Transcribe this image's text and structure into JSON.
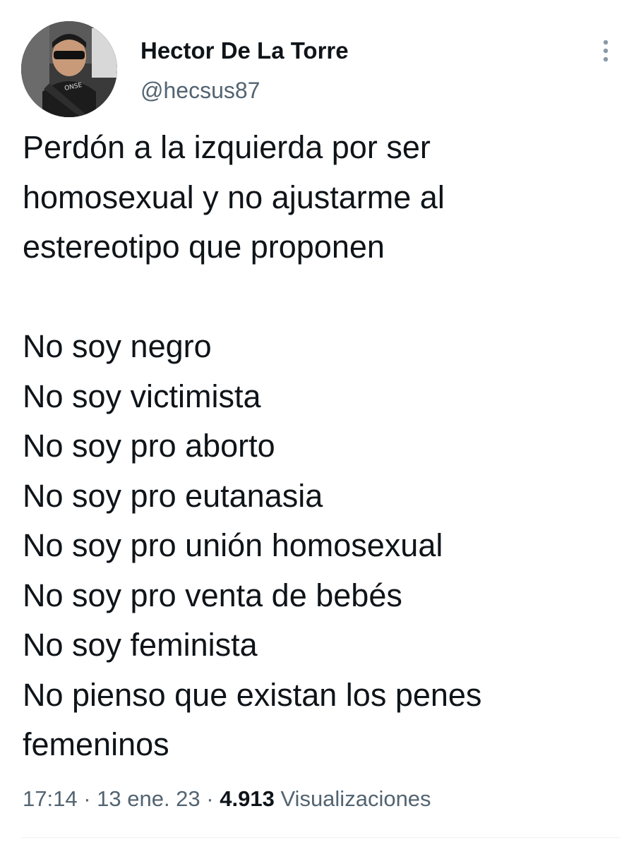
{
  "author": {
    "display_name": "Hector De La Torre",
    "handle": "@hecsus87",
    "avatar_icon": "profile-photo"
  },
  "tweet": {
    "text": "Perdón a la izquierda por ser\nhomosexual y no ajustarme al\nestereotipo que proponen\n\nNo soy negro\nNo soy victimista\nNo soy pro aborto\nNo soy pro eutanasia\nNo soy pro unión homosexual\nNo soy pro venta de bebés\nNo soy feminista\nNo pienso que existan los penes\nfemeninos"
  },
  "meta": {
    "time": "17:14",
    "separator": " · ",
    "date": "13 ene. 23",
    "views_count": "4.913",
    "views_label": "Visualizaciones"
  },
  "icons": {
    "more": "more-vertical-icon"
  },
  "colors": {
    "text_primary": "#0f1419",
    "text_secondary": "#536471",
    "divider": "#eff3f4"
  }
}
